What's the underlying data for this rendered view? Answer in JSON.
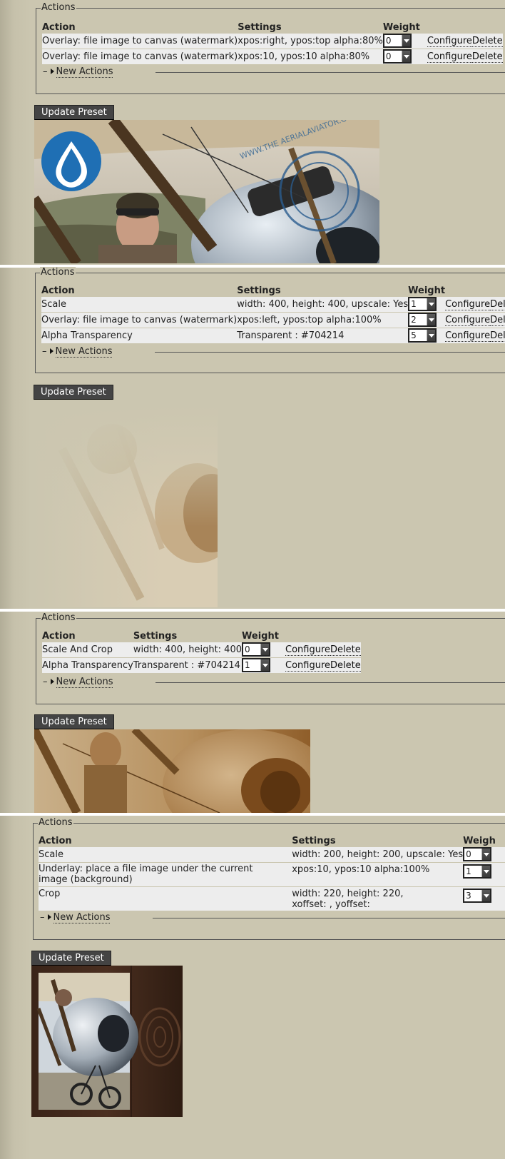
{
  "common": {
    "legend": "Actions",
    "col_action": "Action",
    "col_settings": "Settings",
    "col_weight": "Weight",
    "configure_label": "Configure",
    "delete_label": "Delete",
    "new_actions_label": "New Actions",
    "update_button_label": "Update Preset"
  },
  "panels": [
    {
      "rows": [
        {
          "action": "Overlay: file image to canvas (watermark)",
          "settings": "xpos:right, ypos:top alpha:80%",
          "weight": "0"
        },
        {
          "action": "Overlay: file image to canvas (watermark)",
          "settings": "xpos:10, ypos:10 alpha:80%",
          "weight": "0"
        }
      ],
      "preview_watermark_text": "WWW.THE AERIALAVIATOR.COM"
    },
    {
      "rows": [
        {
          "action": "Scale",
          "settings": "width: 400, height: 400, upscale: Yes",
          "weight": "1"
        },
        {
          "action": "Overlay: file image to canvas (watermark)",
          "settings": "xpos:left, ypos:top alpha:100%",
          "weight": "2"
        },
        {
          "action": "Alpha Transparency",
          "settings": "Transparent : #704214",
          "weight": "5"
        }
      ],
      "configure_delete_truncated": "Dele"
    },
    {
      "rows": [
        {
          "action": "Scale And Crop",
          "settings": "width: 400, height: 400",
          "weight": "0"
        },
        {
          "action": "Alpha Transparency",
          "settings": "Transparent : #704214",
          "weight": "1"
        }
      ]
    },
    {
      "rows": [
        {
          "action": "Scale",
          "settings": "width: 200, height: 200, upscale: Yes",
          "weight": "0"
        },
        {
          "action": "Underlay: place a file image under the current image (background)",
          "settings": "xpos:10, ypos:10 alpha:100%",
          "weight": "1"
        },
        {
          "action": "Crop",
          "settings": "width: 220, height: 220, xoffset: , yoffset:",
          "weight": "3"
        }
      ],
      "col_weight_truncated": "Weigh"
    }
  ],
  "colors": {
    "page_bg": "#cbc6b0",
    "row_bg": "#ededed",
    "button_bg": "#444444",
    "sepia": "#704214",
    "divider": "#ffffff"
  }
}
